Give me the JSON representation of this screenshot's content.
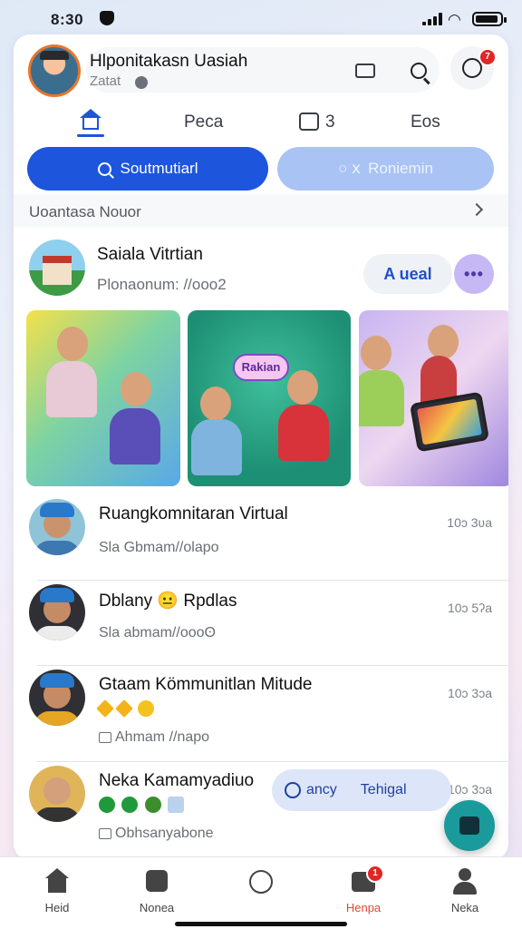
{
  "status_bar": {
    "time": "8:30"
  },
  "header": {
    "title": "Hlponitakasn Uasiah",
    "subtitle": "Zatat",
    "notification_count": "7"
  },
  "tabs": [
    {
      "label": ""
    },
    {
      "label": "Peca"
    },
    {
      "label": "3"
    },
    {
      "label": "Eos"
    }
  ],
  "actions": {
    "primary_label": "Soutmutiarl",
    "secondary_label": "Roniemin",
    "secondary_prefix": "○ ⅹ"
  },
  "section": {
    "label": "Uoantasa Nouor"
  },
  "featured": {
    "title": "Saiala Vitrtian",
    "subtitle": "Plonaonum: //ooo2",
    "local_label": "A ueal",
    "more_label": "•••",
    "photo_caption": "Rakian"
  },
  "list": [
    {
      "title": "Ruangkomnitaran Virtual",
      "subtitle": "Sla Gbmam//olapo",
      "time": "10ɔ 3ʋa"
    },
    {
      "title": "Dblany 😐 Rpdlas",
      "subtitle": "Sla abmam//oooʘ",
      "time": "10ɔ 5ʔa"
    },
    {
      "title": "Gtaam Kömmunitlan Mitude",
      "subtitle": "Ahmam //napo",
      "time": "10ɔ 3ɔa"
    },
    {
      "title": "Neka Kamamyadiuo",
      "subtitle": "Obhsanyabone",
      "time": "10ɔ 3ɔa"
    }
  ],
  "chat_pill": {
    "left": "ancy",
    "right": "Tehigal"
  },
  "bottom_nav": [
    {
      "label": "Heid"
    },
    {
      "label": "Nonea"
    },
    {
      "label": ""
    },
    {
      "label": "Henpa",
      "badge": "1"
    },
    {
      "label": "Neka"
    }
  ],
  "colors": {
    "primary": "#1d55dd",
    "secondary": "#a9c3f5",
    "accent_active": "#e04a2e",
    "fab": "#1a9a9a",
    "badge": "#e02626"
  }
}
